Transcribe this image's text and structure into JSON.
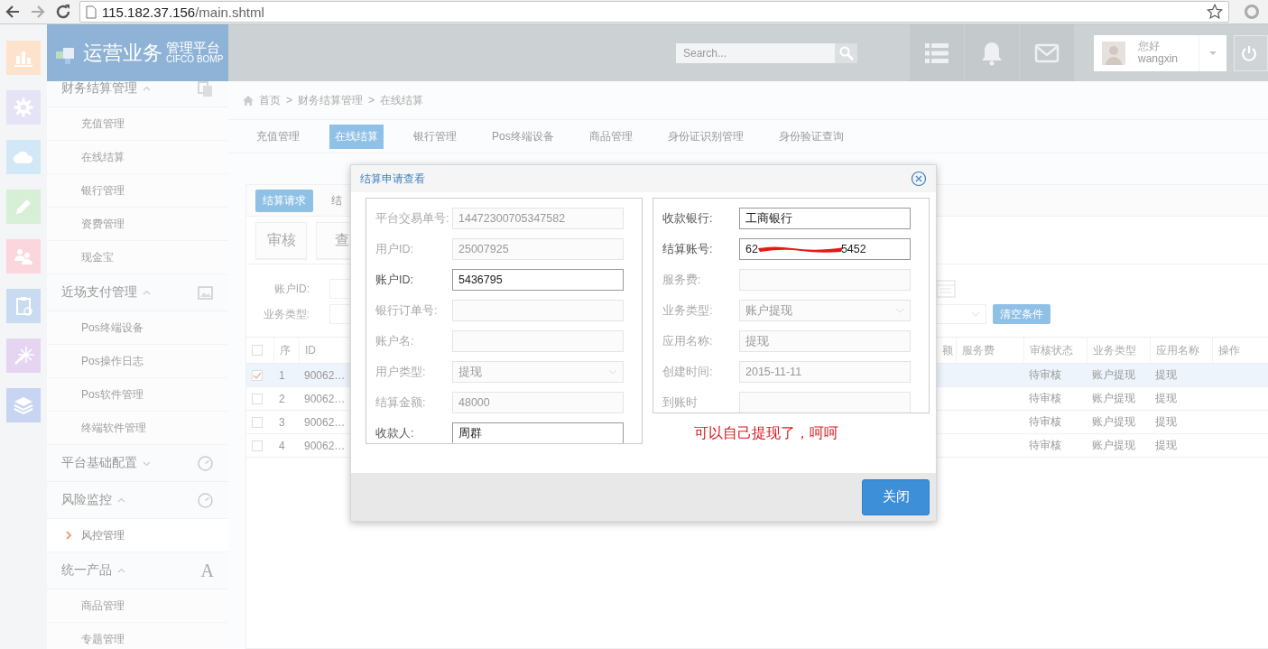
{
  "browser": {
    "url_host": "115.182.37.156",
    "url_path": "/main.shtml"
  },
  "logo": {
    "title": "运营业务",
    "subtitle": "管理平台",
    "tagline": "CIFCO BOMP"
  },
  "topbar": {
    "search": {
      "placeholder": "Search..."
    },
    "user": {
      "greeting": "您好",
      "name": "wangxin"
    }
  },
  "sidebar": {
    "groups": [
      {
        "label": "财务结算管理",
        "expanded": true,
        "children": [
          {
            "label": "充值管理",
            "selected": false
          },
          {
            "label": "在线结算",
            "selected": false
          },
          {
            "label": "银行管理",
            "selected": false
          },
          {
            "label": "资费管理",
            "selected": false
          },
          {
            "label": "现金宝",
            "selected": false
          }
        ]
      },
      {
        "label": "近场支付管理",
        "expanded": true,
        "children": [
          {
            "label": "Pos终端设备",
            "selected": false
          },
          {
            "label": "Pos操作日志",
            "selected": false
          },
          {
            "label": "Pos软件管理",
            "selected": false
          },
          {
            "label": "终端软件管理",
            "selected": false
          }
        ]
      },
      {
        "label": "平台基础配置",
        "expanded": false
      },
      {
        "label": "风险监控",
        "expanded": true,
        "children": [
          {
            "label": "风控管理",
            "selected": true
          }
        ]
      },
      {
        "label": "统一产品",
        "expanded": true,
        "icon_text": "A",
        "children": [
          {
            "label": "商品管理",
            "selected": false
          },
          {
            "label": "专题管理",
            "selected": false
          }
        ]
      }
    ]
  },
  "breadcrumb": {
    "separator": ">",
    "items": [
      "首页",
      "财务结算管理",
      "在线结算"
    ]
  },
  "tabs": [
    {
      "label": "充值管理",
      "selected": false
    },
    {
      "label": "在线结算",
      "selected": true
    },
    {
      "label": "银行管理",
      "selected": false
    },
    {
      "label": "Pos终端设备",
      "selected": false
    },
    {
      "label": "商品管理",
      "selected": false
    },
    {
      "label": "身份证识别管理",
      "selected": false
    },
    {
      "label": "身份验证查询",
      "selected": false
    }
  ],
  "panel": {
    "tabs": [
      {
        "label": "结算请求",
        "selected": true
      },
      {
        "label": "结",
        "selected": false
      }
    ],
    "actions": [
      "审核",
      "查"
    ],
    "filters": [
      {
        "label": "账户ID:",
        "kind": "date"
      },
      {
        "label": "业务类型:",
        "kind": "select"
      }
    ],
    "clear_button": "清空条件",
    "table": {
      "header_checked": false,
      "columns": [
        "序",
        "ID",
        "额",
        "服务费",
        "审核状态",
        "业务类型",
        "应用名称",
        "操作"
      ],
      "rows": [
        {
          "checked": true,
          "no": "1",
          "id": "90062…",
          "status": "待审核",
          "biz_type": "账户提现",
          "app_name": "提现"
        },
        {
          "checked": false,
          "no": "2",
          "id": "90062…",
          "status": "待审核",
          "biz_type": "账户提现",
          "app_name": "提现"
        },
        {
          "checked": false,
          "no": "3",
          "id": "90062…",
          "status": "待审核",
          "biz_type": "账户提现",
          "app_name": "提现"
        },
        {
          "checked": false,
          "no": "4",
          "id": "90062…",
          "status": "待审核",
          "biz_type": "账户提现",
          "app_name": "提现"
        }
      ]
    }
  },
  "dialog": {
    "title": "结算申请查看",
    "left": [
      {
        "label": "平台交易单号:",
        "value": "14472300705347582",
        "disabled": true,
        "kind": "input"
      },
      {
        "label": "用户ID:",
        "value": "25007925",
        "disabled": true,
        "kind": "input"
      },
      {
        "label": "账户ID:",
        "value": "5436795",
        "disabled": false,
        "kind": "input"
      },
      {
        "label": "银行订单号:",
        "disabled": true,
        "kind": "input"
      },
      {
        "label": "账户名:",
        "disabled": true,
        "kind": "input"
      },
      {
        "label": "用户类型:",
        "value": "提现",
        "disabled": true,
        "kind": "select"
      },
      {
        "label": "结算金额:",
        "value": "48000",
        "disabled": true,
        "kind": "input"
      },
      {
        "label": "收款人:",
        "value": "周群",
        "disabled": false,
        "kind": "input"
      }
    ],
    "right": [
      {
        "label": "收款银行:",
        "value": "工商银行",
        "disabled": false,
        "kind": "input"
      },
      {
        "label": "结算账号:",
        "value_start": "62",
        "value_end": "5452",
        "redacted": true,
        "disabled": false,
        "kind": "input"
      },
      {
        "label": "服务费:",
        "disabled": true,
        "kind": "input"
      },
      {
        "label": "业务类型:",
        "value": "账户提现",
        "disabled": true,
        "kind": "select"
      },
      {
        "label": "应用名称:",
        "value": "提现",
        "disabled": true,
        "kind": "input"
      },
      {
        "label": "创建时间:",
        "value": "2015-11-11",
        "disabled": true,
        "kind": "input"
      },
      {
        "label": "到账时",
        "disabled": true,
        "kind": "input"
      }
    ],
    "annotation": "可以自己提现了，呵呵",
    "close_button": "关闭"
  }
}
